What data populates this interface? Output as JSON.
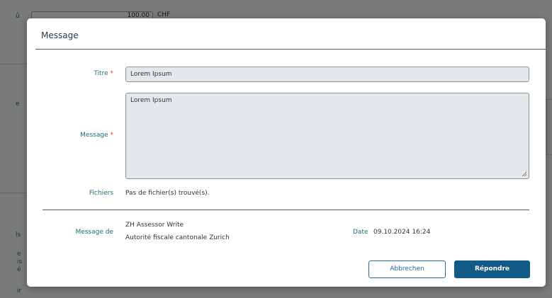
{
  "background": {
    "amount_value": "100.00",
    "currency": "CHF",
    "left_fragments": [
      "û",
      "e",
      "ls",
      "e",
      "is",
      "é",
      "ir"
    ]
  },
  "dialog": {
    "title": "Message",
    "fields": {
      "titre_label": "Titre",
      "titre_value": "Lorem Ipsum",
      "message_label": "Message",
      "message_value": "Lorem Ipsum",
      "required_marker": "*",
      "fichiers_label": "Fichiers",
      "fichiers_value": "Pas de fichier(s) trouvé(s).",
      "message_de_label": "Message de",
      "sender_name": "ZH Assessor Write",
      "sender_org": "Autorité fiscale cantonale  Zurich",
      "date_label": "Date",
      "date_value": "09.10.2024 16:24"
    },
    "buttons": {
      "cancel": "Abbrechen",
      "reply": "Répondre"
    }
  },
  "colors": {
    "label_teal": "#1b6f78",
    "required_red": "#d2332b",
    "primary_button": "#135b87",
    "secondary_border": "#1f6e98"
  }
}
